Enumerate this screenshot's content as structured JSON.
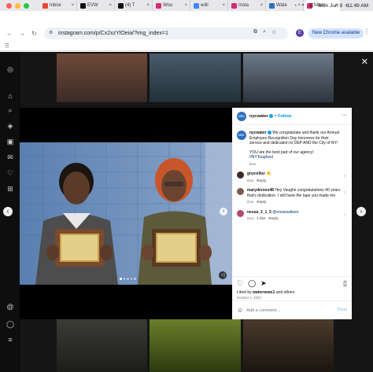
{
  "menubar": {
    "tabs": [
      {
        "label": "Inbox",
        "icon": "gmail-icon",
        "color": "#ea4335"
      },
      {
        "label": "EVW",
        "icon": "x-icon",
        "color": "#111111"
      },
      {
        "label": "(4) T",
        "icon": "threads-icon",
        "color": "#111111"
      },
      {
        "label": "Woo",
        "icon": "instagram-icon",
        "color": "#d62976"
      },
      {
        "label": "willi",
        "icon": "google-icon",
        "color": "#4285f4"
      },
      {
        "label": "Insta",
        "icon": "instagram-icon",
        "color": "#d62976"
      },
      {
        "label": "Wate",
        "icon": "web-icon",
        "color": "#2e6fbf"
      },
      {
        "label": "Miam",
        "icon": "instagram-icon",
        "color": "#d62976"
      }
    ],
    "new_tab": "+",
    "system": {
      "date": "Mon Jun 9",
      "time": "11:49 AM"
    }
  },
  "addressbar": {
    "url": "instagram.com/p/Cx2xzYlOeia/?img_index=1",
    "profile_initial": "E",
    "chrome_available": "New Chrome available"
  },
  "post": {
    "username": "nycwater",
    "avatar_text": "NYC WATER",
    "follow_label": "Follow",
    "dot": "•",
    "caption_user": "nycwater",
    "caption_text": "We congratulate and thank our Annual Employee Recognition Day honorees for their service and dedication to DEP AND the City of NY!",
    "caption_text2": "YOU are the best part of our agency!",
    "hashtag": "#NYToughest",
    "caption_age": "81w",
    "comments": [
      {
        "user": "gnyce9oz",
        "text": "👏",
        "age": "81w",
        "reply": "Reply",
        "likes": ""
      },
      {
        "user": "marydeross48",
        "text": "Hey Vaughn congratulations 40 years that's dedication. I still have the tape you made me",
        "age": "81w",
        "reply": "Reply",
        "likes": ""
      },
      {
        "user": "nessa_2_1_5",
        "text": "@msansaileen",
        "age": "81w",
        "reply": "Reply",
        "likes": "1 like"
      }
    ],
    "liked_prefix": "Liked by",
    "liked_user": "waternews1",
    "liked_suffix": "and others",
    "date": "October 1, 2023",
    "comment_placeholder": "Add a comment...",
    "post_label": "Post"
  },
  "colors": {
    "accent": "#0095f6",
    "overlay": "#151515"
  }
}
